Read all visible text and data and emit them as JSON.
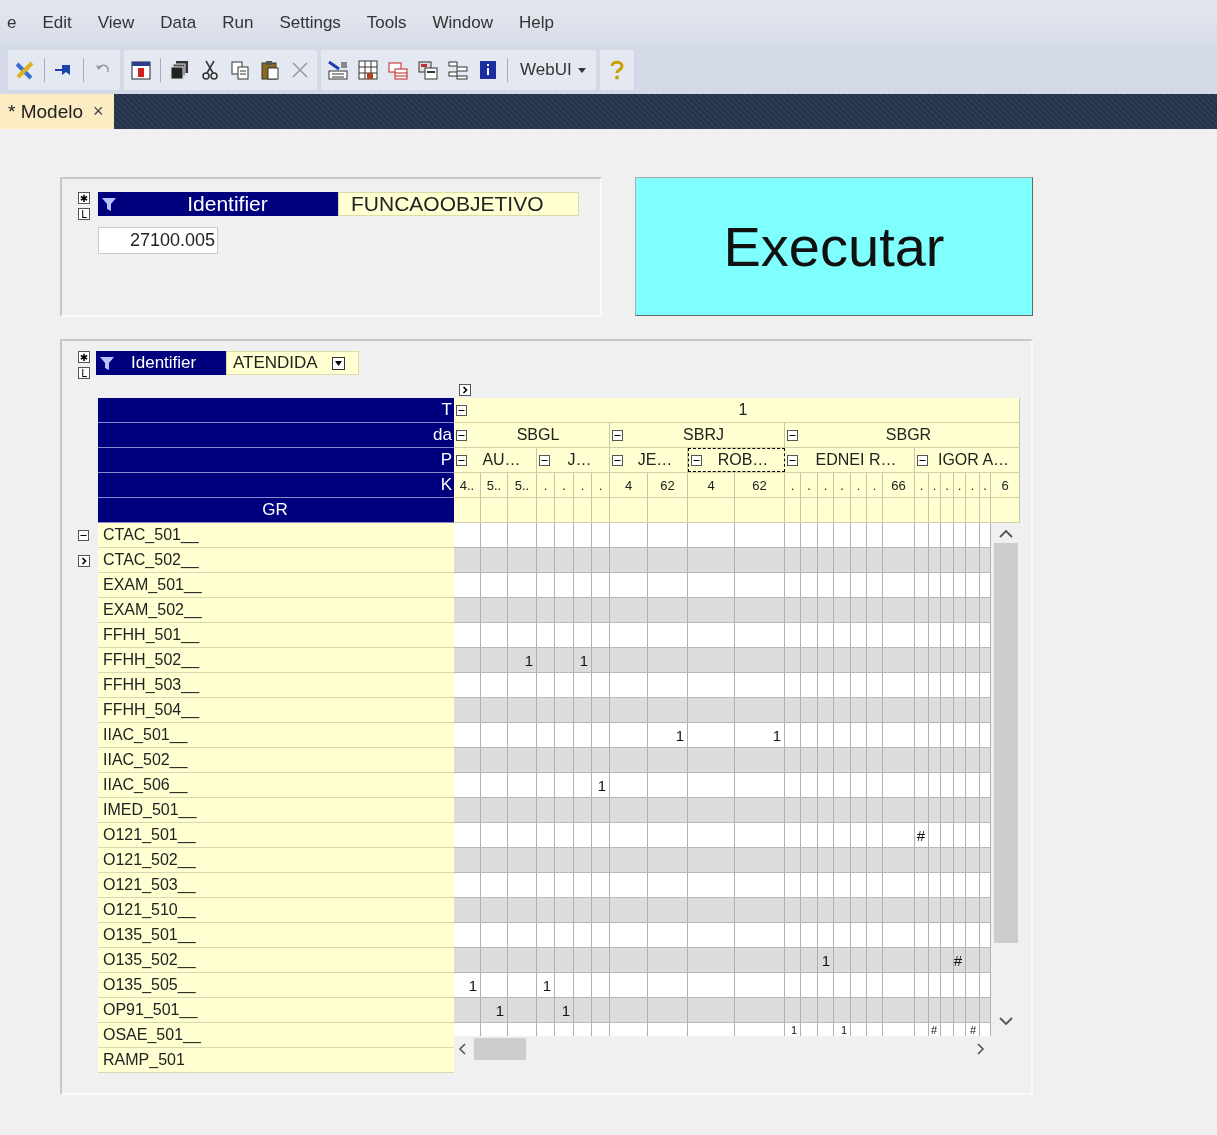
{
  "menu": [
    {
      "label": "e"
    },
    {
      "label": "Edit"
    },
    {
      "label": "View"
    },
    {
      "label": "Data"
    },
    {
      "label": "Run"
    },
    {
      "label": "Settings"
    },
    {
      "label": "Tools"
    },
    {
      "label": "Window"
    },
    {
      "label": "Help"
    }
  ],
  "toolbar": {
    "dropdown": "WebUI"
  },
  "tab": {
    "title": "* Modelo",
    "close": "×"
  },
  "objective_panel": {
    "corner_buttons": [
      "✱",
      "L"
    ],
    "header": "Identifier",
    "identifier": "FUNCAOOBJETIVO",
    "value": "27100.005"
  },
  "execute_button": {
    "label": "Executar"
  },
  "result_panel": {
    "corner_buttons": [
      "✱",
      "L"
    ],
    "header": "Identifier",
    "identifier": "ATENDIDA",
    "row_dimensions": [
      "T",
      "da",
      "P",
      "K"
    ],
    "row_header": "GR",
    "columns": [
      {
        "label": "1",
        "expanded": true,
        "children": [
          {
            "label": "SBGL",
            "expanded": true,
            "children": [
              {
                "label": "AU…",
                "expanded": true,
                "selected": false,
                "children": [
                  {
                    "label": "4.."
                  },
                  {
                    "label": "5.."
                  },
                  {
                    "label": "5.."
                  }
                ]
              },
              {
                "label": "J…",
                "expanded": true,
                "selected": false,
                "children": [
                  {
                    "label": "."
                  },
                  {
                    "label": "."
                  },
                  {
                    "label": "."
                  },
                  {
                    "label": "."
                  }
                ]
              }
            ]
          },
          {
            "label": "SBRJ",
            "expanded": true,
            "children": [
              {
                "label": "JE…",
                "expanded": true,
                "selected": false,
                "children": [
                  {
                    "label": "4"
                  },
                  {
                    "label": "62"
                  }
                ]
              },
              {
                "label": "ROB…",
                "expanded": true,
                "selected": true,
                "children": [
                  {
                    "label": "4"
                  },
                  {
                    "label": "62"
                  }
                ]
              }
            ]
          },
          {
            "label": "SBGR",
            "expanded": true,
            "children": [
              {
                "label": "EDNEI R…",
                "expanded": true,
                "selected": false,
                "children": [
                  {
                    "label": "."
                  },
                  {
                    "label": "."
                  },
                  {
                    "label": "."
                  },
                  {
                    "label": "."
                  },
                  {
                    "label": "."
                  },
                  {
                    "label": "."
                  },
                  {
                    "label": "66"
                  }
                ]
              },
              {
                "label": "IGOR A…",
                "expanded": true,
                "selected": false,
                "children": [
                  {
                    "label": "."
                  },
                  {
                    "label": "."
                  },
                  {
                    "label": "."
                  },
                  {
                    "label": "."
                  },
                  {
                    "label": "."
                  },
                  {
                    "label": "."
                  },
                  {
                    "label": "6"
                  }
                ]
              }
            ]
          }
        ]
      }
    ],
    "rows": [
      {
        "label": "CTAC_501__",
        "expanded": true,
        "cells": [
          null,
          null,
          null,
          null,
          null,
          null,
          null,
          null,
          null,
          null,
          null,
          null,
          null,
          null,
          null,
          null,
          null,
          null,
          null,
          null,
          null,
          null,
          null,
          null
        ]
      },
      {
        "label": "CTAC_502__",
        "expanded": false,
        "cells": [
          null,
          null,
          null,
          null,
          null,
          null,
          null,
          null,
          null,
          null,
          null,
          null,
          null,
          null,
          null,
          null,
          null,
          null,
          null,
          null,
          null,
          null,
          null,
          null
        ]
      },
      {
        "label": "EXAM_501__",
        "cells": [
          null,
          null,
          null,
          null,
          null,
          null,
          null,
          null,
          null,
          null,
          null,
          null,
          null,
          null,
          null,
          null,
          null,
          null,
          null,
          null,
          null,
          null,
          null,
          null
        ]
      },
      {
        "label": "EXAM_502__",
        "cells": [
          null,
          null,
          null,
          null,
          null,
          null,
          null,
          null,
          null,
          null,
          null,
          null,
          null,
          null,
          null,
          null,
          null,
          null,
          null,
          null,
          null,
          null,
          null,
          null
        ]
      },
      {
        "label": "FFHH_501__",
        "cells": [
          null,
          null,
          null,
          null,
          null,
          null,
          null,
          null,
          null,
          null,
          null,
          null,
          null,
          null,
          null,
          null,
          null,
          null,
          null,
          null,
          null,
          null,
          null,
          null
        ]
      },
      {
        "label": "FFHH_502__",
        "cells": [
          null,
          null,
          "1",
          null,
          null,
          "1",
          null,
          null,
          null,
          null,
          null,
          null,
          null,
          null,
          null,
          null,
          null,
          null,
          null,
          null,
          null,
          null,
          null,
          null
        ]
      },
      {
        "label": "FFHH_503__",
        "cells": [
          null,
          null,
          null,
          null,
          null,
          null,
          null,
          null,
          null,
          null,
          null,
          null,
          null,
          null,
          null,
          null,
          null,
          null,
          null,
          null,
          null,
          null,
          null,
          null
        ]
      },
      {
        "label": "FFHH_504__",
        "cells": [
          null,
          null,
          null,
          null,
          null,
          null,
          null,
          null,
          null,
          null,
          null,
          null,
          null,
          null,
          null,
          null,
          null,
          null,
          null,
          null,
          null,
          null,
          null,
          null
        ]
      },
      {
        "label": "IIAC_501__",
        "cells": [
          null,
          null,
          null,
          null,
          null,
          null,
          null,
          null,
          "1",
          null,
          "1",
          null,
          null,
          null,
          null,
          null,
          null,
          null,
          null,
          null,
          null,
          null,
          null,
          null
        ]
      },
      {
        "label": "IIAC_502__",
        "cells": [
          null,
          null,
          null,
          null,
          null,
          null,
          null,
          null,
          null,
          null,
          null,
          null,
          null,
          null,
          null,
          null,
          null,
          null,
          null,
          null,
          null,
          null,
          null,
          null
        ]
      },
      {
        "label": "IIAC_506__",
        "cells": [
          null,
          null,
          null,
          null,
          null,
          null,
          "1",
          null,
          null,
          null,
          null,
          null,
          null,
          null,
          null,
          null,
          null,
          null,
          null,
          null,
          null,
          null,
          null,
          null
        ]
      },
      {
        "label": "IMED_501__",
        "cells": [
          null,
          null,
          null,
          null,
          null,
          null,
          null,
          null,
          null,
          null,
          null,
          null,
          null,
          null,
          null,
          null,
          null,
          null,
          null,
          null,
          null,
          null,
          null,
          null
        ]
      },
      {
        "label": "O121_501__",
        "cells": [
          null,
          null,
          null,
          null,
          null,
          null,
          null,
          null,
          null,
          null,
          null,
          null,
          null,
          null,
          null,
          null,
          null,
          null,
          "#",
          null,
          null,
          null,
          null,
          null
        ]
      },
      {
        "label": "O121_502__",
        "cells": [
          null,
          null,
          null,
          null,
          null,
          null,
          null,
          null,
          null,
          null,
          null,
          null,
          null,
          null,
          null,
          null,
          null,
          null,
          null,
          null,
          null,
          null,
          null,
          null
        ]
      },
      {
        "label": "O121_503__",
        "cells": [
          null,
          null,
          null,
          null,
          null,
          null,
          null,
          null,
          null,
          null,
          null,
          null,
          null,
          null,
          null,
          null,
          null,
          null,
          null,
          null,
          null,
          null,
          null,
          null
        ]
      },
      {
        "label": "O121_510__",
        "cells": [
          null,
          null,
          null,
          null,
          null,
          null,
          null,
          null,
          null,
          null,
          null,
          null,
          null,
          null,
          null,
          null,
          null,
          null,
          null,
          null,
          null,
          null,
          null,
          null
        ]
      },
      {
        "label": "O135_501__",
        "cells": [
          null,
          null,
          null,
          null,
          null,
          null,
          null,
          null,
          null,
          null,
          null,
          null,
          null,
          null,
          null,
          null,
          null,
          null,
          null,
          null,
          null,
          null,
          null,
          null
        ]
      },
      {
        "label": "O135_502__",
        "cells": [
          null,
          null,
          null,
          null,
          null,
          null,
          null,
          null,
          null,
          null,
          null,
          null,
          null,
          "1",
          null,
          null,
          null,
          null,
          null,
          null,
          null,
          "#",
          null,
          null
        ]
      },
      {
        "label": "O135_505__",
        "cells": [
          "1",
          null,
          null,
          "1",
          null,
          null,
          null,
          null,
          null,
          null,
          null,
          null,
          null,
          null,
          null,
          null,
          null,
          null,
          null,
          null,
          null,
          null,
          null,
          null
        ]
      },
      {
        "label": "OP91_501__",
        "cells": [
          null,
          "1",
          null,
          null,
          "1",
          null,
          null,
          null,
          null,
          null,
          null,
          null,
          null,
          null,
          null,
          null,
          null,
          null,
          null,
          null,
          null,
          null,
          null,
          null
        ]
      },
      {
        "label": "OSAE_501__",
        "cells": [
          null,
          null,
          null,
          null,
          null,
          null,
          null,
          null,
          null,
          null,
          null,
          "1",
          null,
          null,
          "1",
          null,
          null,
          null,
          null,
          "#",
          null,
          null,
          "#",
          null
        ]
      },
      {
        "label": "RAMP_501"
      }
    ]
  }
}
